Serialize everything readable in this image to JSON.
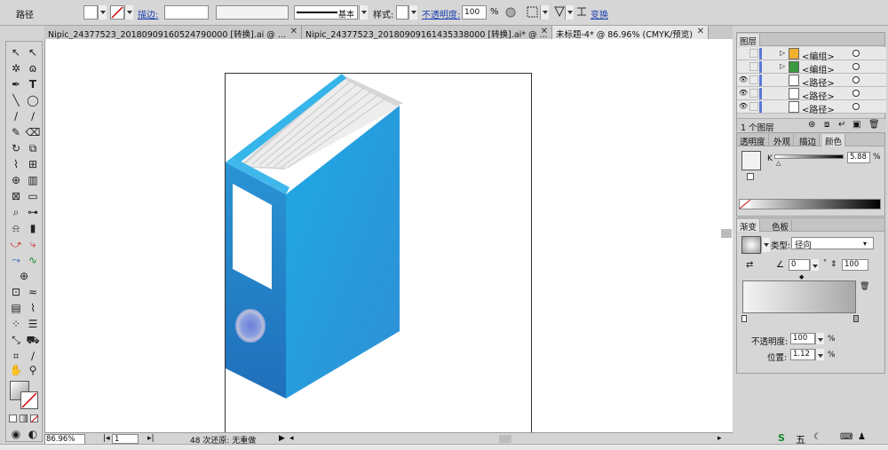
{
  "control_bar": {
    "object_type": "路径",
    "stroke_label": "描边:",
    "brush_label": "基本",
    "style_label": "样式:",
    "opacity_label": "不透明度:",
    "opacity_value": "100",
    "opacity_unit": "%",
    "transform_label": "变换"
  },
  "doc_tabs": [
    {
      "label": "Nipic_24377523_20180909160524790000 [转换].ai @ ..."
    },
    {
      "label": "Nipic_24377523_20180909161435338000 [转换].ai* @ ..."
    },
    {
      "label": "未标题-4* @ 86.96% (CMYK/预览)"
    }
  ],
  "status_bar": {
    "zoom": "86.96%",
    "page": "1",
    "history": "48 次还原: 无重做"
  },
  "layers_panel": {
    "title": "图层",
    "rows": [
      {
        "name": "<编组>"
      },
      {
        "name": "<编组>"
      },
      {
        "name": "<路径>"
      },
      {
        "name": "<路径>"
      },
      {
        "name": "<路径>"
      }
    ],
    "footer": "1 个图层"
  },
  "color_panel": {
    "tabs": [
      "透明度",
      "外观",
      "描边",
      "颜色"
    ],
    "channel": "K",
    "value": "5.88",
    "unit": "%"
  },
  "gradient_panel": {
    "tabs": [
      "渐变",
      "色板"
    ],
    "type_label": "类型:",
    "type_value": "径向",
    "angle": "0",
    "aspect": "100",
    "opacity_label": "不透明度:",
    "opacity_value": "100",
    "location_label": "位置:",
    "location_value": "1.12",
    "unit": "%"
  },
  "taskbar": {
    "ime_label": "五"
  },
  "colors": {
    "binder_front": "#2e95d6",
    "binder_side": "#1f79c0",
    "binder_top": "#36b5ea",
    "pages": "#e8e8e8"
  }
}
